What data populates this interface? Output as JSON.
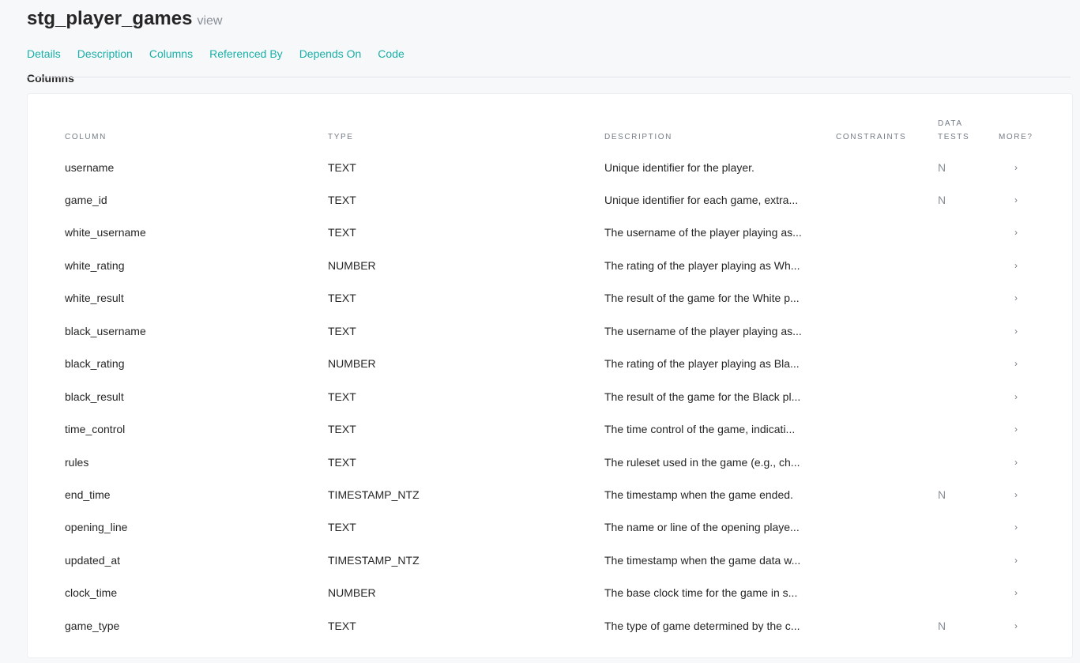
{
  "header": {
    "title": "stg_player_games",
    "type": "view"
  },
  "tabs": [
    "Details",
    "Description",
    "Columns",
    "Referenced By",
    "Depends On",
    "Code"
  ],
  "section": {
    "label": "Columns"
  },
  "table": {
    "headers": {
      "column": "COLUMN",
      "type": "TYPE",
      "description": "DESCRIPTION",
      "constraints": "CONSTRAINTS",
      "data_tests_1": "DATA",
      "data_tests_2": "TESTS",
      "more": "MORE?"
    },
    "rows": [
      {
        "column": "username",
        "type": "TEXT",
        "description": "Unique identifier for the player.",
        "tests": "N"
      },
      {
        "column": "game_id",
        "type": "TEXT",
        "description": "Unique identifier for each game, extra...",
        "tests": "N"
      },
      {
        "column": "white_username",
        "type": "TEXT",
        "description": "The username of the player playing as...",
        "tests": ""
      },
      {
        "column": "white_rating",
        "type": "NUMBER",
        "description": "The rating of the player playing as Wh...",
        "tests": ""
      },
      {
        "column": "white_result",
        "type": "TEXT",
        "description": "The result of the game for the White p...",
        "tests": ""
      },
      {
        "column": "black_username",
        "type": "TEXT",
        "description": "The username of the player playing as...",
        "tests": ""
      },
      {
        "column": "black_rating",
        "type": "NUMBER",
        "description": "The rating of the player playing as Bla...",
        "tests": ""
      },
      {
        "column": "black_result",
        "type": "TEXT",
        "description": "The result of the game for the Black pl...",
        "tests": ""
      },
      {
        "column": "time_control",
        "type": "TEXT",
        "description": "The time control of the game, indicati...",
        "tests": ""
      },
      {
        "column": "rules",
        "type": "TEXT",
        "description": "The ruleset used in the game (e.g., ch...",
        "tests": ""
      },
      {
        "column": "end_time",
        "type": "TIMESTAMP_NTZ",
        "description": "The timestamp when the game ended.",
        "tests": "N"
      },
      {
        "column": "opening_line",
        "type": "TEXT",
        "description": "The name or line of the opening playe...",
        "tests": ""
      },
      {
        "column": "updated_at",
        "type": "TIMESTAMP_NTZ",
        "description": "The timestamp when the game data w...",
        "tests": ""
      },
      {
        "column": "clock_time",
        "type": "NUMBER",
        "description": "The base clock time for the game in s...",
        "tests": ""
      },
      {
        "column": "game_type",
        "type": "TEXT",
        "description": "The type of game determined by the c...",
        "tests": "N"
      }
    ],
    "more_glyph": "›"
  },
  "colors": {
    "accent": "#1ab0a8",
    "background": "#f7f8fa",
    "card": "#ffffff"
  }
}
